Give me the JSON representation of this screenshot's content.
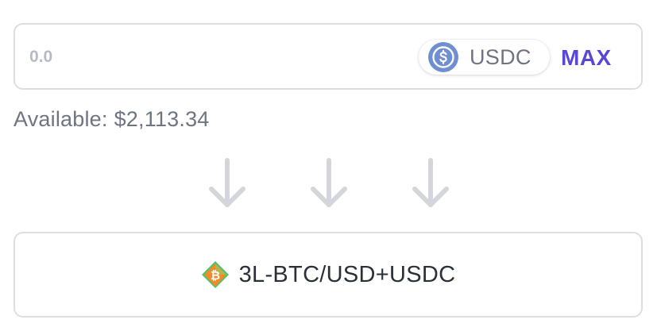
{
  "amount": {
    "value": "",
    "placeholder": "0.0"
  },
  "token": {
    "symbol": "USDC",
    "icon": "usdc-coin-icon",
    "icon_color": "#2775ca"
  },
  "max_label": "MAX",
  "available": {
    "label": "Available:",
    "value": "$2,113.34"
  },
  "arrows": [
    "arrow-down-icon",
    "arrow-down-icon",
    "arrow-down-icon"
  ],
  "output": {
    "label": "3L-BTC/USD+USDC",
    "icon": "bitcoin-leveraged-icon"
  },
  "colors": {
    "accent": "#5848d4",
    "border": "#dcdee3",
    "muted_text": "#6f7482",
    "arrow": "#d4d6db",
    "bitcoin_orange": "#f28a2b",
    "leverage_green": "#4cc46a"
  }
}
